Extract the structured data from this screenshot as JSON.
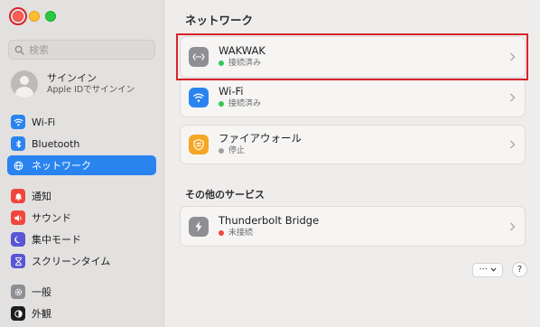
{
  "window": {
    "title": "ネットワーク"
  },
  "search": {
    "placeholder": "検索"
  },
  "account": {
    "title": "サインイン",
    "subtitle": "Apple IDでサインイン"
  },
  "sidebar": {
    "group1": [
      {
        "label": "Wi-Fi",
        "icon": "wifi-icon",
        "color": "#2a84f0"
      },
      {
        "label": "Bluetooth",
        "icon": "bluetooth-icon",
        "color": "#2a84f0"
      },
      {
        "label": "ネットワーク",
        "icon": "globe-icon",
        "color": "#2a84f0",
        "active": true
      }
    ],
    "group2": [
      {
        "label": "通知",
        "icon": "bell-icon",
        "color": "#f0463c"
      },
      {
        "label": "サウンド",
        "icon": "speaker-icon",
        "color": "#f0463c"
      },
      {
        "label": "集中モード",
        "icon": "moon-icon",
        "color": "#5a55d6"
      },
      {
        "label": "スクリーンタイム",
        "icon": "hourglass-icon",
        "color": "#5a55d6"
      }
    ],
    "group3": [
      {
        "label": "一般",
        "icon": "gear-icon",
        "color": "#8e8e93"
      },
      {
        "label": "外観",
        "icon": "appearance-icon",
        "color": "#1d1d1f"
      }
    ]
  },
  "services": [
    {
      "name": "WAKWAK",
      "status": "接続済み",
      "status_color": "#34c759",
      "icon": "vpn-dots-icon",
      "icon_bg": "#8e8e93"
    },
    {
      "name": "Wi-Fi",
      "status": "接続済み",
      "status_color": "#34c759",
      "icon": "wifi-icon",
      "icon_bg": "#2a84f0"
    },
    {
      "name": "ファイアウォール",
      "status": "停止",
      "status_color": "#a0a0a0",
      "icon": "firewall-icon",
      "icon_bg": "#f5a623"
    }
  ],
  "other_section": {
    "title": "その他のサービス"
  },
  "other_services": [
    {
      "name": "Thunderbolt Bridge",
      "status": "未接続",
      "status_color": "#f0463c",
      "icon": "thunderbolt-icon",
      "icon_bg": "#8e8e93"
    }
  ],
  "footer": {
    "more_label": "···",
    "help_label": "?"
  }
}
